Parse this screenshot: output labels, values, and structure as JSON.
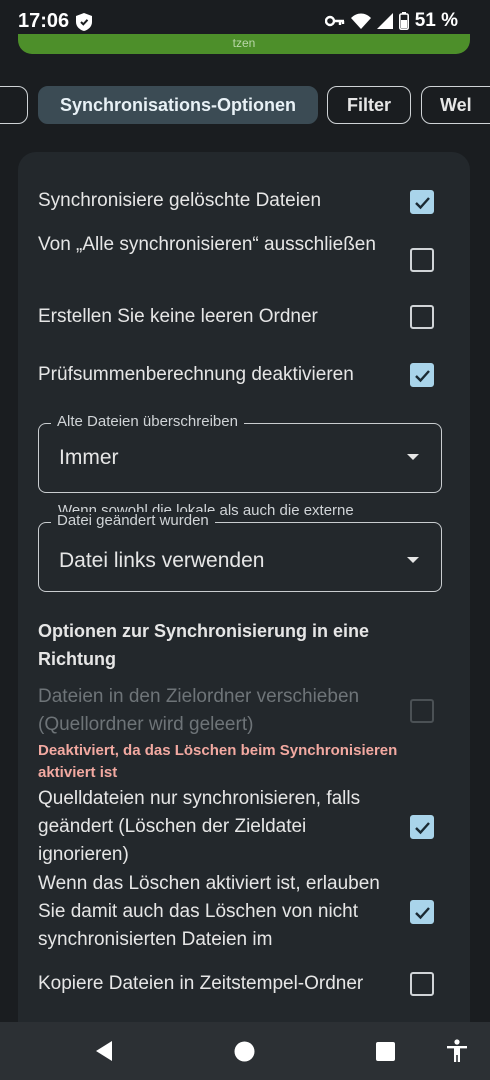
{
  "status_bar": {
    "time": "17:06",
    "battery": "51 %",
    "icons": [
      "shield-icon",
      "key-icon",
      "wifi-icon",
      "signal-icon",
      "battery-icon"
    ]
  },
  "top_banner": {
    "text": "tzen"
  },
  "tabs": [
    {
      "label": ""
    },
    {
      "label": "Synchronisations-Optionen",
      "active": true
    },
    {
      "label": "Filter"
    },
    {
      "label": "Wel"
    }
  ],
  "options": {
    "sync_deleted": {
      "label": "Synchronisiere gelöschte Dateien",
      "checked": true
    },
    "exclude_sync_all": {
      "label": "Von „Alle synchronisieren“ ausschließen",
      "checked": false
    },
    "no_empty_folders": {
      "label": "Erstellen Sie keine leeren Ordner",
      "checked": false
    },
    "disable_checksum": {
      "label": "Prüfsummenberechnung deaktivieren",
      "checked": true
    }
  },
  "overwrite_old": {
    "label": "Alte Dateien überschreiben",
    "value": "Immer"
  },
  "conflict": {
    "label_line1": "Wenn sowohl die lokale als auch die externe",
    "label_line2": "Datei geändert wurden",
    "value": "Datei links verwenden"
  },
  "one_way": {
    "title": "Optionen zur Synchronisierung in eine Richtung",
    "move_files": {
      "label": "Dateien in den Zielordner verschieben (Quellordner wird geleert)",
      "checked": false,
      "disabled": true
    },
    "move_files_error": "Deaktiviert, da das Löschen beim Synchronisieren aktiviert ist",
    "only_changed": {
      "label": "Quelldateien nur synchronisieren, falls geändert (Löschen der Zieldatei ignorieren)",
      "checked": true
    },
    "allow_delete_unsynced": {
      "label": "Wenn das Löschen aktiviert ist, erlauben Sie damit auch das Löschen von nicht synchronisierten Dateien im",
      "checked": true
    },
    "copy_timestamp": {
      "label": "Kopiere Dateien in Zeitstempel-Ordner",
      "checked": false
    }
  },
  "colors": {
    "accent": "#a9d4ea",
    "active_chip": "#3b4b54",
    "error": "#f2a9a1",
    "banner": "#4d8f2a"
  },
  "nav_bar": {
    "icons": [
      "back-icon",
      "home-icon",
      "recents-icon",
      "accessibility-icon"
    ]
  }
}
